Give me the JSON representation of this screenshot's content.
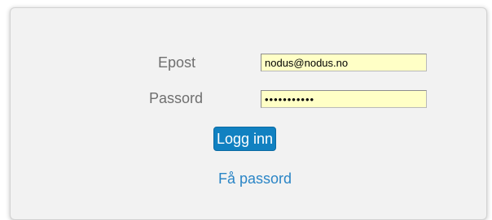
{
  "login_form": {
    "email_label": "Epost",
    "email_value": "nodus@nodus.no",
    "password_label": "Passord",
    "password_masked": "•••••••••••",
    "login_button": "Logg inn",
    "forgot_password_link": "Få passord",
    "field_bg_color": "#ffffc6",
    "accent_color": "#1181c1",
    "link_color": "#2a85c6"
  }
}
